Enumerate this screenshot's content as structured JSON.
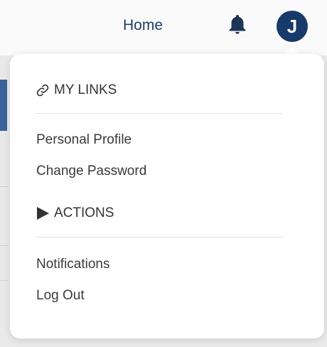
{
  "header": {
    "home_label": "Home",
    "avatar_initial": "J"
  },
  "dropdown": {
    "my_links": {
      "title": "MY LINKS",
      "icon": "link-icon",
      "items": [
        {
          "label": "Personal Profile"
        },
        {
          "label": "Change Password"
        }
      ]
    },
    "actions": {
      "title": "ACTIONS",
      "icon": "play-icon",
      "items": [
        {
          "label": "Notifications"
        },
        {
          "label": "Log Out"
        }
      ]
    }
  },
  "colors": {
    "brand_navy": "#173a6a",
    "bell": "#1d3557",
    "text": "#3a3a3a"
  }
}
